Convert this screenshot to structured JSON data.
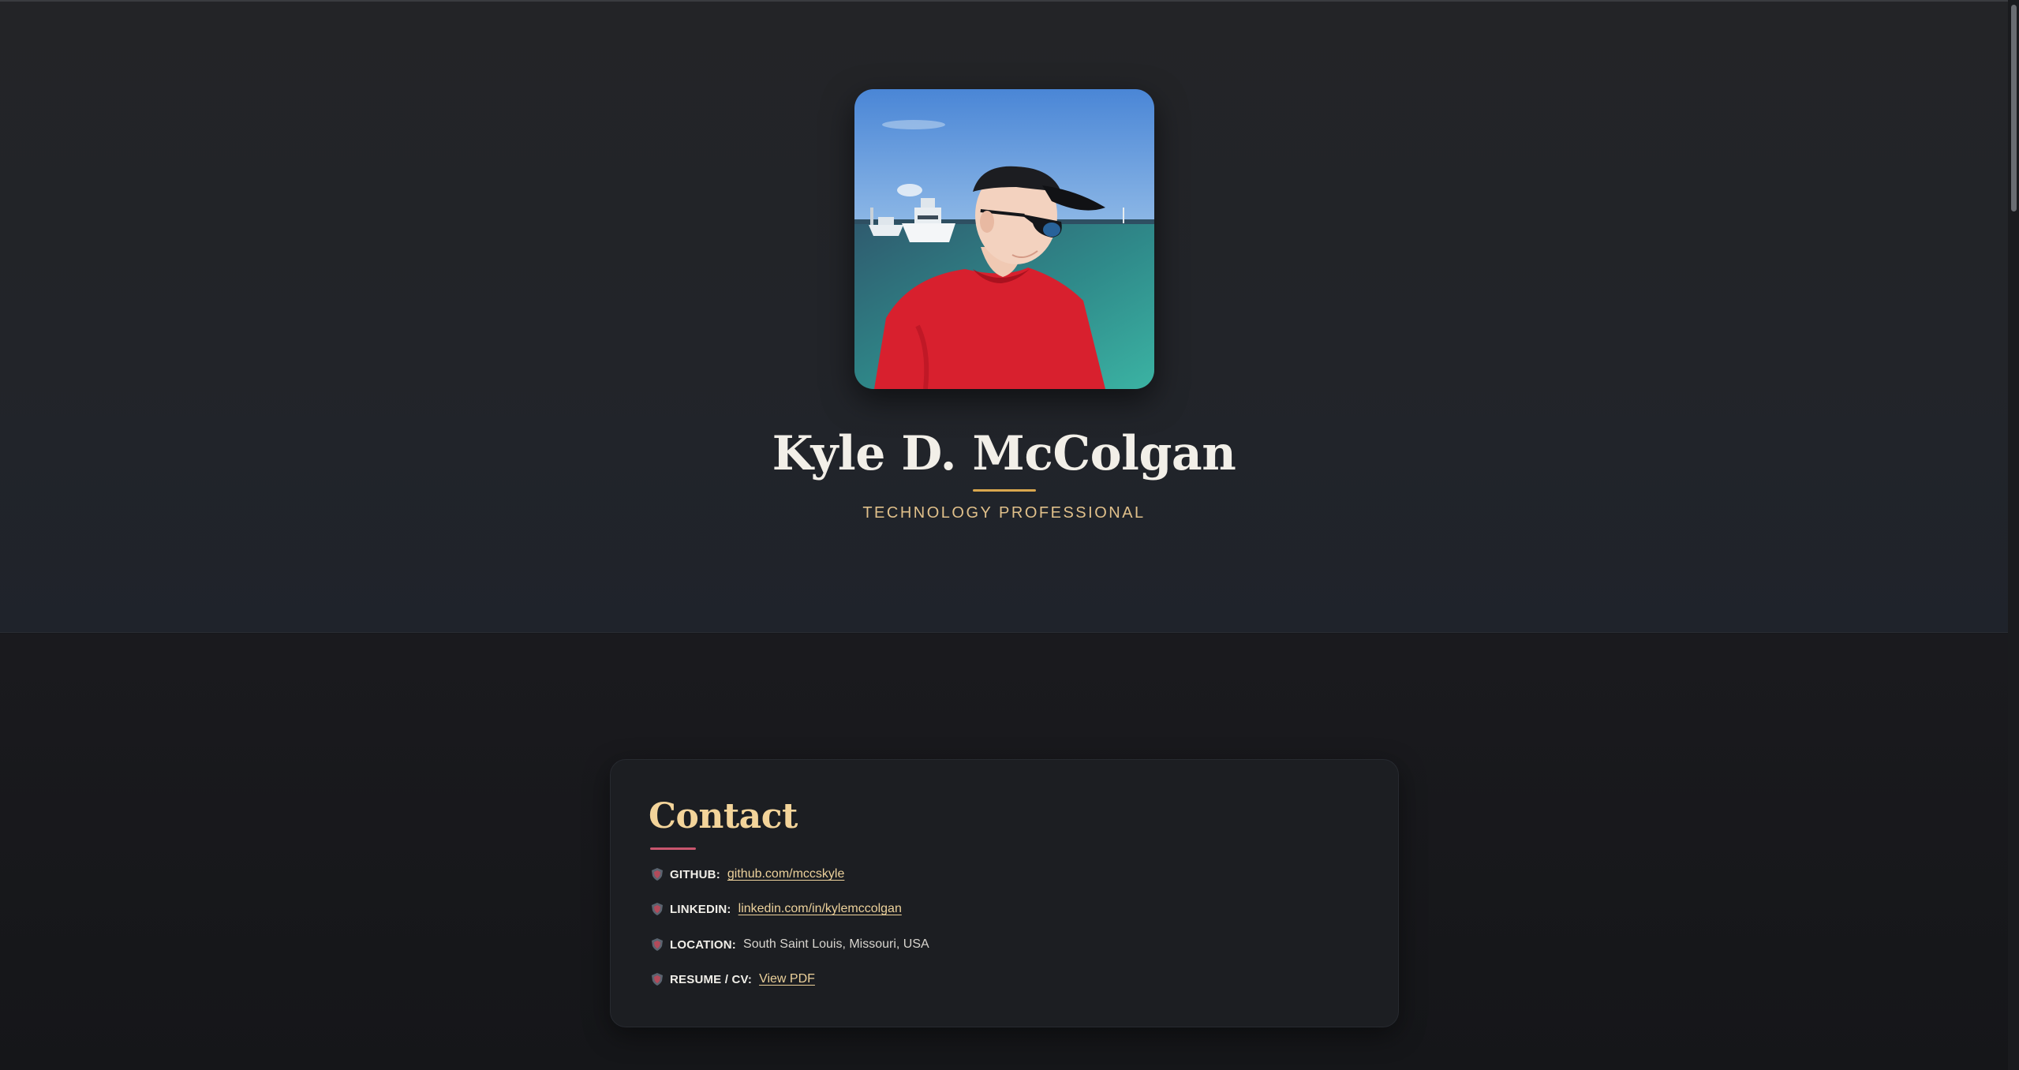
{
  "hero": {
    "name": "Kyle D. McColgan",
    "subtitle": "TECHNOLOGY PROFESSIONAL",
    "avatar_alt": "Kyle D. McColgan"
  },
  "contact": {
    "title": "Contact",
    "items": [
      {
        "label": "GITHUB:",
        "value": "github.com/mccskyle",
        "is_link": true,
        "icon": "badge-icon"
      },
      {
        "label": "LINKEDIN:",
        "value": "linkedin.com/in/kylemccolgan",
        "is_link": true,
        "icon": "badge-icon"
      },
      {
        "label": "LOCATION:",
        "value": "South Saint Louis, Missouri, USA",
        "is_link": false,
        "icon": "badge-icon"
      },
      {
        "label": "RESUME / CV:",
        "value": "View PDF",
        "is_link": true,
        "icon": "badge-icon"
      }
    ]
  },
  "colors": {
    "accent_gold": "#d9a74e",
    "title_gold": "#f3d49a",
    "underline_rose": "#c9566e",
    "background": "#16171b"
  }
}
